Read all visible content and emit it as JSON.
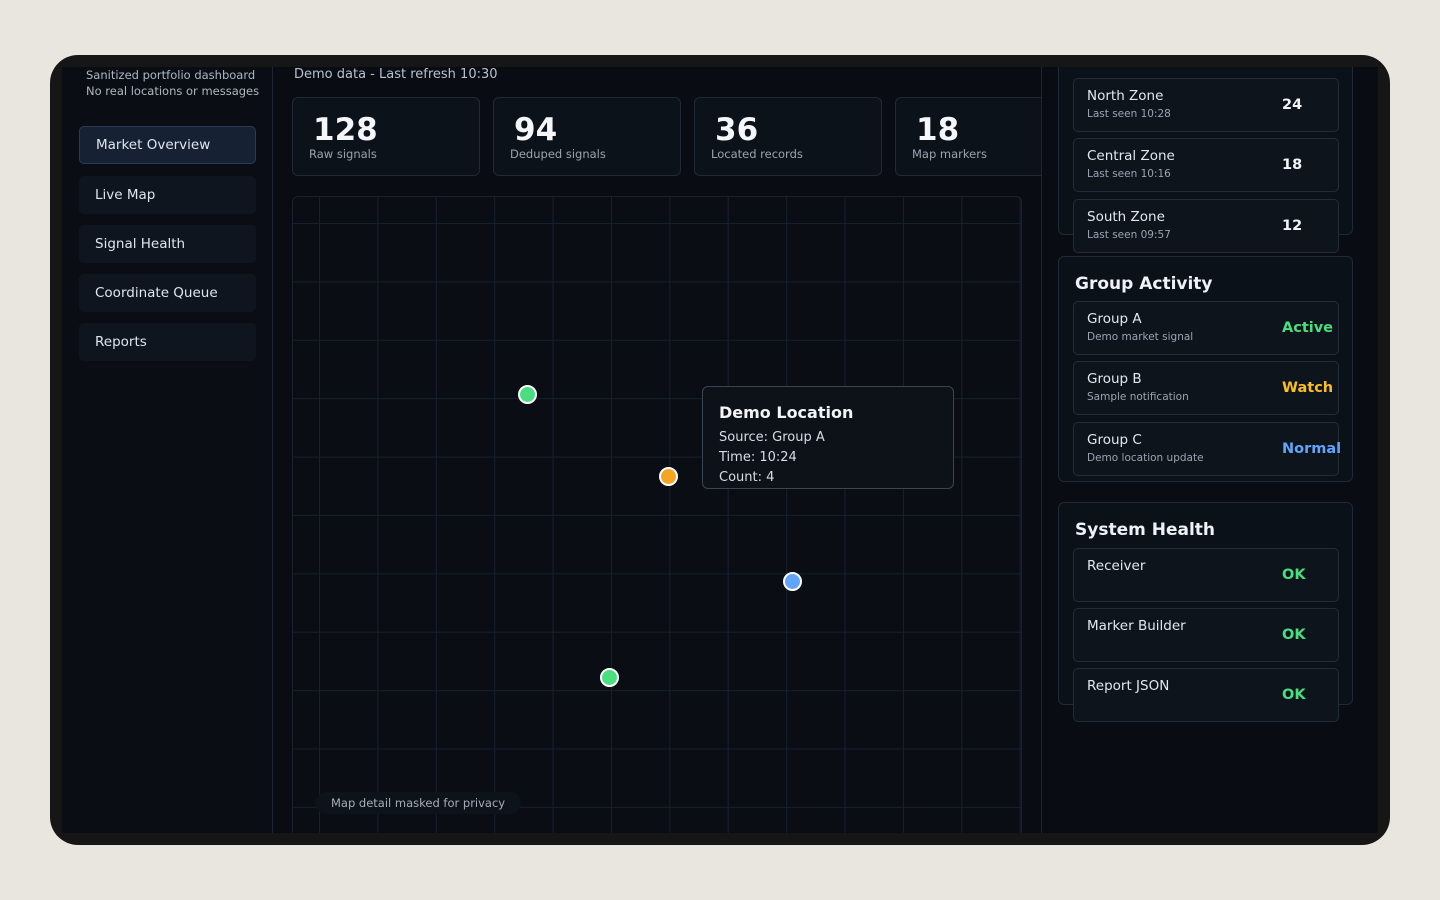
{
  "sidebar": {
    "note_line1": "Sanitized portfolio dashboard",
    "note_line2": "No real locations or messages",
    "items": [
      {
        "label": "Market Overview",
        "active": true
      },
      {
        "label": "Live Map"
      },
      {
        "label": "Signal Health"
      },
      {
        "label": "Coordinate Queue"
      },
      {
        "label": "Reports"
      }
    ]
  },
  "header": {
    "subtitle": "Demo data - Last refresh 10:30"
  },
  "stats": [
    {
      "value": "128",
      "label": "Raw signals"
    },
    {
      "value": "94",
      "label": "Deduped signals"
    },
    {
      "value": "36",
      "label": "Located records"
    },
    {
      "value": "18",
      "label": "Map markers"
    }
  ],
  "map": {
    "marker_colors": [
      "#4ade80",
      "#f5a524",
      "#60a5fa",
      "#4ade80"
    ],
    "tooltip": {
      "title": "Demo Location",
      "source": "Source: Group A",
      "time": "Time: 10:24",
      "count": "Count: 4"
    },
    "mask_note": "Map detail masked for privacy"
  },
  "zones": {
    "items": [
      {
        "name": "North Zone",
        "sub": "Last seen 10:28",
        "value": "24"
      },
      {
        "name": "Central Zone",
        "sub": "Last seen 10:16",
        "value": "18"
      },
      {
        "name": "South Zone",
        "sub": "Last seen 09:57",
        "value": "12"
      }
    ]
  },
  "group_activity": {
    "title": "Group Activity",
    "items": [
      {
        "name": "Group A",
        "sub": "Demo market signal",
        "status": "Active",
        "color": "#4ade80"
      },
      {
        "name": "Group B",
        "sub": "Sample notification",
        "status": "Watch",
        "color": "#fbbf24"
      },
      {
        "name": "Group C",
        "sub": "Demo location update",
        "status": "Normal",
        "color": "#60a5fa"
      }
    ]
  },
  "system_health": {
    "title": "System Health",
    "items": [
      {
        "name": "Receiver",
        "status": "OK",
        "color": "#4ade80"
      },
      {
        "name": "Marker Builder",
        "status": "OK",
        "color": "#4ade80"
      },
      {
        "name": "Report JSON",
        "status": "OK",
        "color": "#4ade80"
      }
    ]
  }
}
